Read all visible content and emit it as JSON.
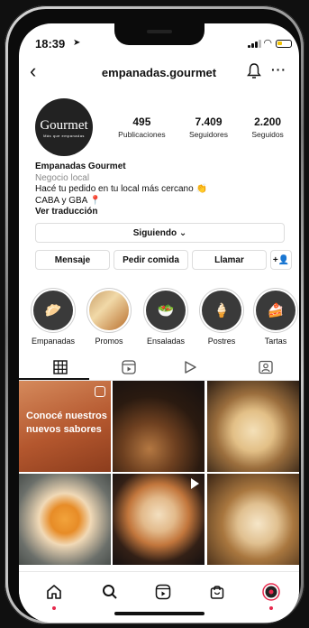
{
  "status": {
    "time": "18:39",
    "location_icon": "location-arrow-icon",
    "battery_color": "#f2c200"
  },
  "header": {
    "username": "empanadas.gourmet",
    "back_icon": "chevron-left-icon",
    "bell_icon": "bell-icon",
    "more_icon": "more-icon"
  },
  "profile": {
    "avatar_title": "Gourmet",
    "avatar_subtitle": "Más que empanadas",
    "stats": [
      {
        "number": "495",
        "label": "Publicaciones"
      },
      {
        "number": "7.409",
        "label": "Seguidores"
      },
      {
        "number": "2.200",
        "label": "Seguidos"
      }
    ],
    "name": "Empanadas Gourmet",
    "category": "Negocio local",
    "bio_line1": "Hacé tu pedido en tu local más cercano 👏",
    "bio_line2": "CABA y GBA 📍",
    "translate": "Ver traducción"
  },
  "buttons": {
    "following": "Siguiendo ⌄",
    "message": "Mensaje",
    "order": "Pedir comida",
    "call": "Llamar",
    "add_person": "+👤"
  },
  "highlights": [
    {
      "label": "Empanadas",
      "icon": "🥟"
    },
    {
      "label": "Promos",
      "icon": ""
    },
    {
      "label": "Ensaladas",
      "icon": "🥗"
    },
    {
      "label": "Postres",
      "icon": "🍦"
    },
    {
      "label": "Tartas",
      "icon": "🍰"
    }
  ],
  "grid": {
    "post1_text_line1": "Conocé nuestros",
    "post1_text_line2": "nuevos sabores"
  },
  "accent": "#e6284c"
}
